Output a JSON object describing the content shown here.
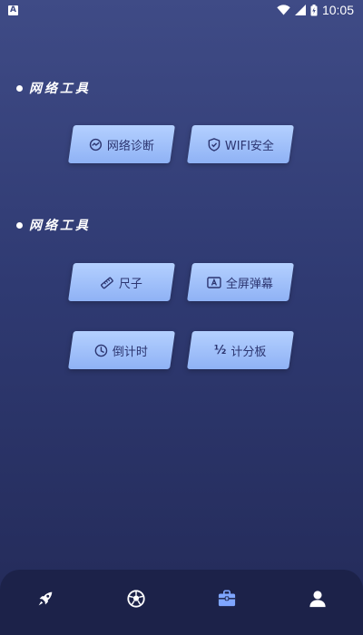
{
  "status_bar": {
    "notification_label": "A",
    "time": "10:05"
  },
  "sections": [
    {
      "title": "网络工具",
      "tools": [
        {
          "label": "网络诊断",
          "icon": "network-diagnosis-icon"
        },
        {
          "label": "WIFI安全",
          "icon": "shield-icon"
        }
      ]
    },
    {
      "title": "网络工具",
      "tools": [
        {
          "label": "尺子",
          "icon": "ruler-icon"
        },
        {
          "label": "全屏弹幕",
          "icon": "screen-text-icon"
        },
        {
          "label": "倒计时",
          "icon": "clock-icon"
        },
        {
          "label": "计分板",
          "icon": "fraction-icon",
          "icon_text": "½"
        }
      ]
    }
  ],
  "bottom_nav": [
    {
      "icon": "rocket-icon",
      "active": false
    },
    {
      "icon": "globe-ball-icon",
      "active": false
    },
    {
      "icon": "toolbox-icon",
      "active": true
    },
    {
      "icon": "user-icon",
      "active": false
    }
  ],
  "colors": {
    "background_top": "#3f4b86",
    "background_bottom": "#232a58",
    "button_fill": "#a9c6fb",
    "button_text": "#2c3570",
    "nav_bar": "#1c2249",
    "nav_active": "#7fa6ff"
  }
}
